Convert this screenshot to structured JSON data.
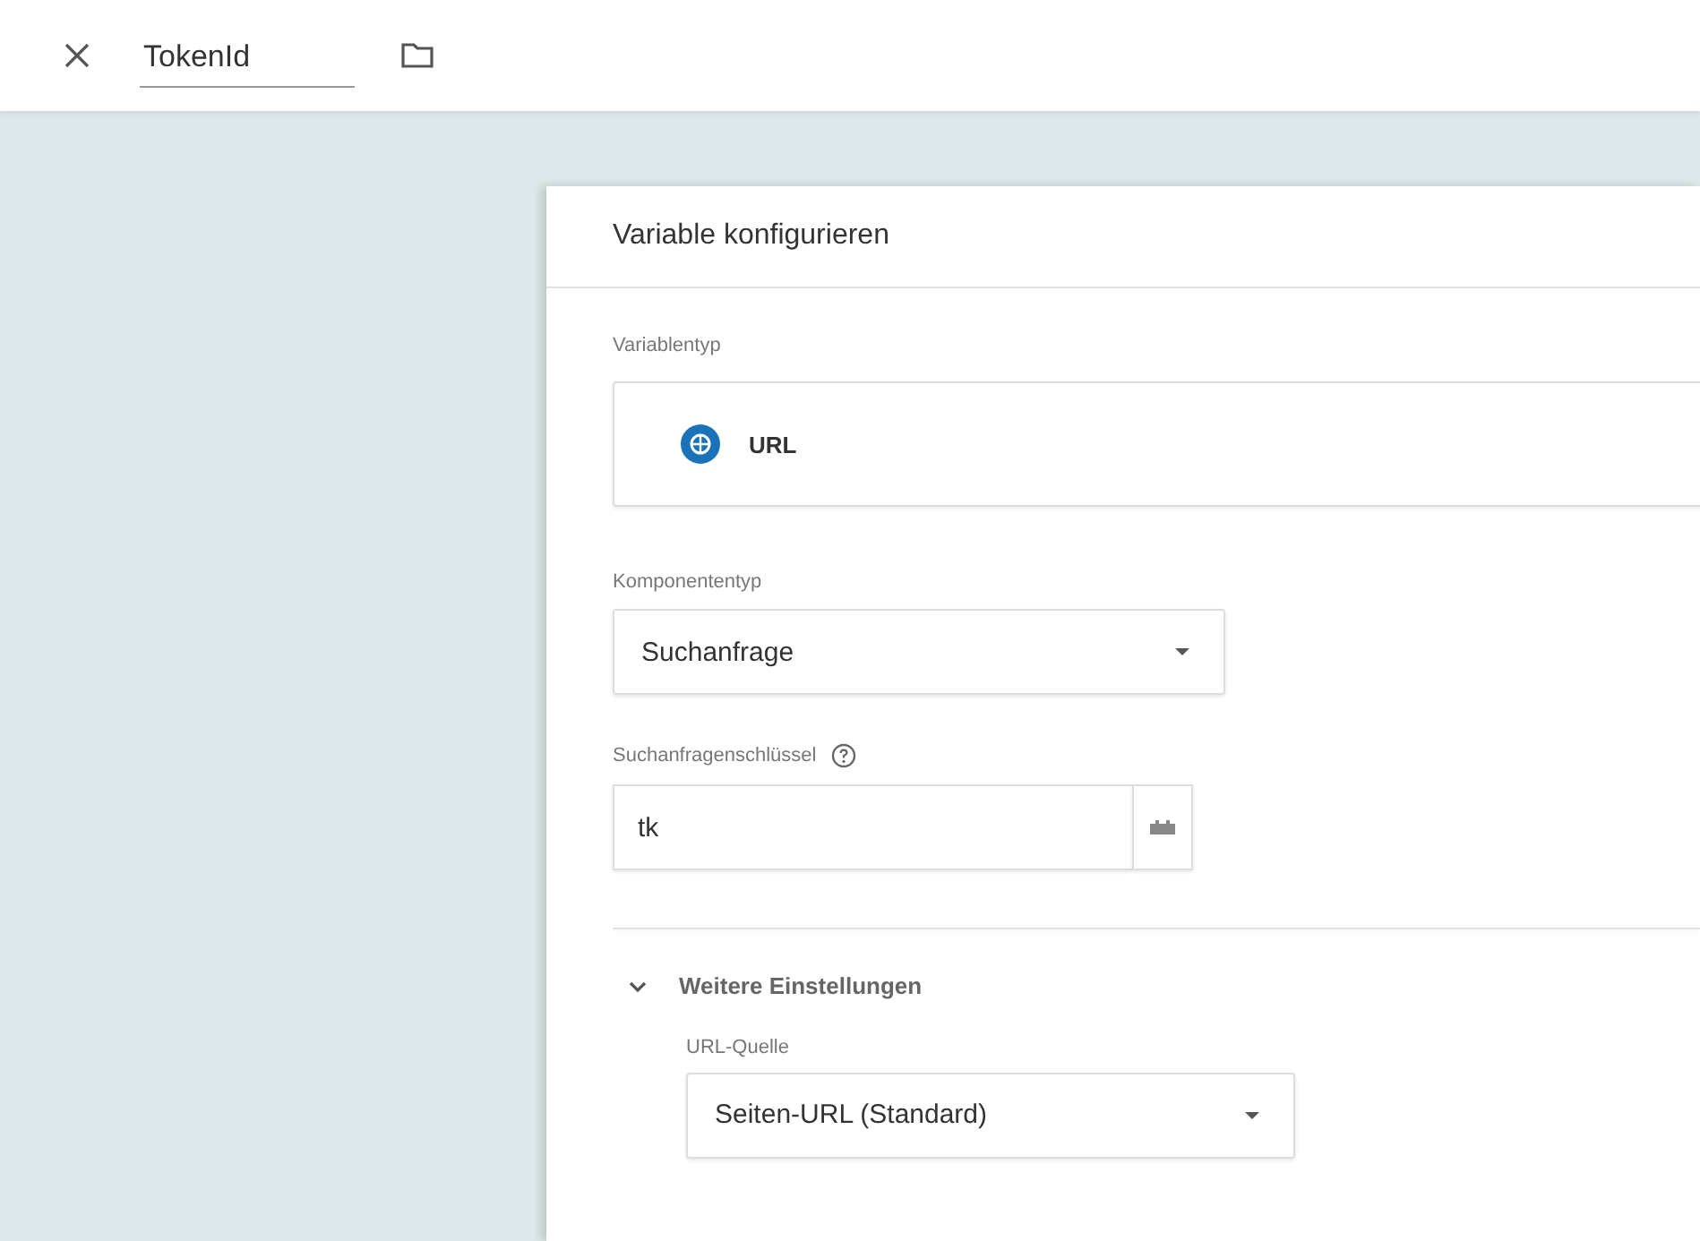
{
  "header": {
    "title": "TokenId"
  },
  "card": {
    "title": "Variable konfigurieren",
    "variable_type": {
      "label": "Variablentyp",
      "value": "URL"
    },
    "component_type": {
      "label": "Komponententyp",
      "value": "Suchanfrage"
    },
    "query_key": {
      "label": "Suchanfragenschlüssel",
      "value": "tk"
    },
    "more_settings": {
      "label": "Weitere Einstellungen",
      "expanded": true,
      "url_source": {
        "label": "URL-Quelle",
        "value": "Seiten-URL (Standard)"
      }
    }
  }
}
